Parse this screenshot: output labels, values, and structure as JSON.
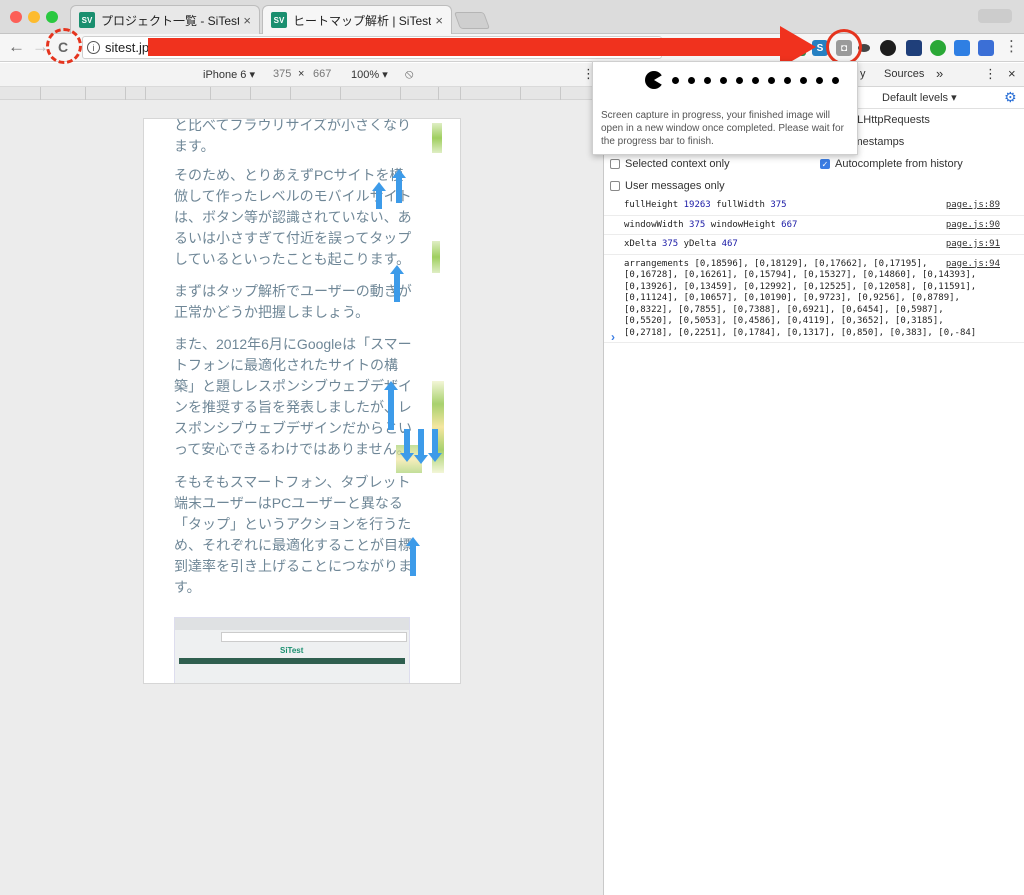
{
  "tabs": [
    {
      "label": "プロジェクト一覧 - SiTest",
      "favicon": "SV",
      "close": "×"
    },
    {
      "label": "ヒートマップ解析 | SiTest",
      "favicon": "SV",
      "close": "×"
    }
  ],
  "toolbar": {
    "url": "sitest.jp/",
    "back": "←",
    "forward": "→",
    "reload": "C",
    "info": "i"
  },
  "device": {
    "name": "iPhone 6 ▾",
    "width": "375",
    "times": "×",
    "height": "667",
    "zoom": "100% ▾",
    "rotate": "⦸"
  },
  "page": {
    "paragraphs": [
      "と比べてフラウリサイズが小さくなります。",
      "そのため、とりあえずPCサイトを模倣して作ったレベルのモバイルサイトは、ボタン等が認識されていない、あるいは小さすぎて付近を誤ってタップしているといったことも起こります。",
      "まずはタップ解析でユーザーの動きが正常かどうか把握しましょう。",
      "また、2012年6月にGoogleは「スマートフォンに最適化されたサイトの構築」と題しレスポンシブウェブデザインを推奨する旨を発表しましたが、レスポンシブウェブデザインだからといって安心できるわけではありません。",
      "そもそもスマートフォン、タブレット端末ユーザーはPCユーザーと異なる「タップ」というアクションを行うため、それぞれに最適化することが目標到達率を引き上げることにつながります。"
    ],
    "thumb_brand": "SiTest"
  },
  "devtools": {
    "tabs": [
      "y",
      "Sources",
      "»",
      "⋮",
      "×"
    ],
    "default_levels": "Default levels ▾",
    "options": {
      "xhr": "MLHttpRequests",
      "timestamps": "timestamps",
      "selected_context": "Selected context only",
      "autocomplete": "Autocomplete from history",
      "user_messages": "User messages only"
    },
    "logs": [
      {
        "a": "fullHeight ",
        "n1": "19263",
        "b": " fullWidth ",
        "n2": "375",
        "src": "page.js:89"
      },
      {
        "a": "windowWidth ",
        "n1": "375",
        "b": " windowHeight ",
        "n2": "667",
        "src": "page.js:90"
      },
      {
        "a": "xDelta ",
        "n1": "375",
        "b": " yDelta ",
        "n2": "467",
        "src": "page.js:91"
      }
    ],
    "arrangements_text": "arrangements [0,18596], [0,18129], [0,17662], [0,17195],\n[0,16728], [0,16261], [0,15794], [0,15327], [0,14860], [0,14393],\n[0,13926], [0,13459], [0,12992], [0,12525], [0,12058], [0,11591],\n[0,11124], [0,10657], [0,10190], [0,9723], [0,9256], [0,8789],\n[0,8322], [0,7855], [0,7388], [0,6921], [0,6454], [0,5987],\n[0,5520], [0,5053], [0,4586], [0,4119], [0,3652], [0,3185],\n[0,2718], [0,2251], [0,1784], [0,1317], [0,850], [0,383], [0,-84]",
    "arrangements_src": "page.js:94",
    "prompt": "›"
  },
  "popup": {
    "message": "Screen capture in progress, your finished image will open in a new window once completed. Please wait for the progress bar to finish."
  },
  "colors": {
    "annotation_red": "#f0321e",
    "page_text": "#6f8797",
    "tap_arrow_blue": "#3d9be9",
    "brand_green": "#1a8f6f"
  }
}
